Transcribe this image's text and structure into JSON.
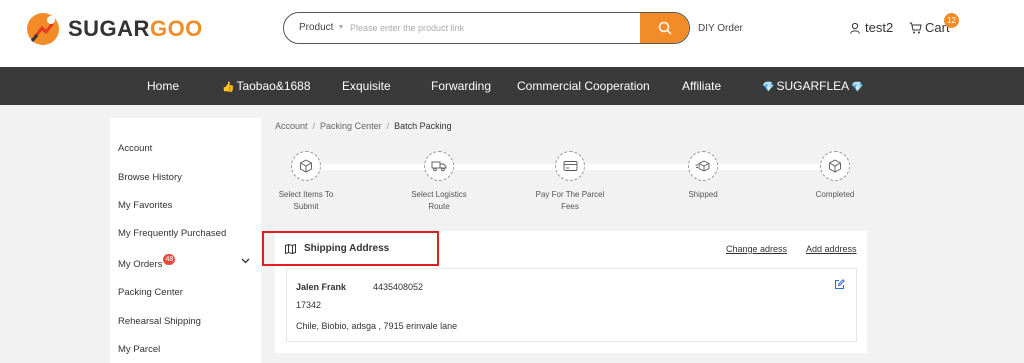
{
  "brand": {
    "name_part1": "SUGAR",
    "name_part2": "GOO",
    "accent": "#f28c28"
  },
  "search": {
    "type_label": "Product",
    "placeholder": "Please enter the product link"
  },
  "header": {
    "diy_order": "DIY Order",
    "username": "test2",
    "cart_label": "Cart",
    "cart_count": "12"
  },
  "nav": {
    "home": "Home",
    "taobao": "Taobao&1688",
    "exquisite": "Exquisite",
    "forwarding": "Forwarding",
    "commercial": "Commercial Cooperation",
    "affiliate": "Affiliate",
    "sugarflea": "SUGARFLEA"
  },
  "sidebar": {
    "items": [
      "Account",
      "Browse History",
      "My Favorites",
      "My Frequently Purchased",
      "My Orders",
      "Packing Center",
      "Rehearsal Shipping",
      "My Parcel"
    ],
    "orders_badge": "48"
  },
  "breadcrumb": {
    "level1": "Account",
    "level2": "Packing Center",
    "current": "Batch Packing"
  },
  "steps": {
    "s1_line1": "Select Items To",
    "s1_line2": "Submit",
    "s2_line1": "Select Logistics",
    "s2_line2": "Route",
    "s3_line1": "Pay For The Parcel",
    "s3_line2": "Fees",
    "s4_line1": "Shipped",
    "s5_line1": "Completed"
  },
  "shipping": {
    "title": "Shipping Address",
    "change_link": "Change adress",
    "add_link": "Add address",
    "name": "Jalen Frank",
    "phone": "4435408052",
    "zip": "17342",
    "address": "Chile, Biobio, adsga , 7915 erinvale lane"
  },
  "icons": {
    "search": "search-icon",
    "user": "user-icon",
    "cart": "cart-icon",
    "thumb": "thumbs-up-icon",
    "diamond": "diamond-icon",
    "map": "map-icon",
    "edit": "edit-icon",
    "chevron": "chevron-down-icon"
  }
}
